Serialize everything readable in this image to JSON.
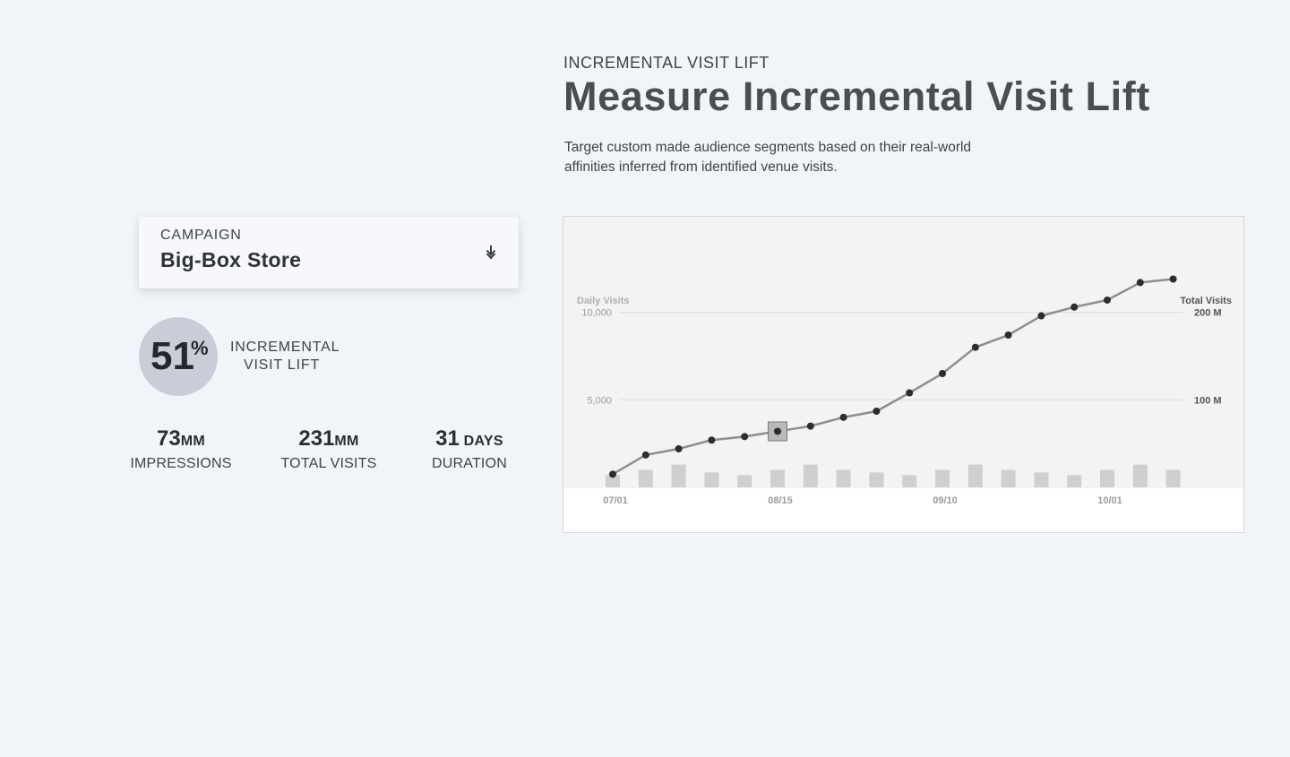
{
  "header": {
    "eyebrow": "INCREMENTAL VISIT LIFT",
    "title": "Measure Incremental Visit Lift",
    "description": "Target custom made audience segments based on their real-world affinities inferred from identified venue visits."
  },
  "campaign": {
    "label": "CAMPAIGN",
    "value": "Big-Box Store",
    "download_icon": "download-icon"
  },
  "lift": {
    "value": "51",
    "unit": "%",
    "label_line1": "INCREMENTAL",
    "label_line2": "VISIT LIFT"
  },
  "stats": [
    {
      "value": "73",
      "unit": "MM",
      "label": "IMPRESSIONS"
    },
    {
      "value": "231",
      "unit": "MM",
      "label": "TOTAL VISITS"
    },
    {
      "value": "31",
      "unit": " DAYS",
      "label": "DURATION"
    }
  ],
  "colors": {
    "background": "#f1f4f9",
    "chart_panel": "#f3f3f3",
    "line": "#8e8e8e",
    "point": "#2d2d2d",
    "bar": "#cfcfcf",
    "circle": "#c9cdd8"
  },
  "chart_data": {
    "type": "line",
    "left_axis": {
      "title": "Daily Visits",
      "ticks": [
        "10,000",
        "5,000"
      ],
      "tick_values": [
        10000,
        5000
      ],
      "range": [
        0,
        13000
      ]
    },
    "right_axis": {
      "title": "Total Visits",
      "ticks": [
        "200 M",
        "100 M"
      ],
      "tick_values": [
        200,
        100
      ],
      "range": [
        0,
        260
      ]
    },
    "x_ticks": [
      {
        "label": "07/01",
        "index": 0
      },
      {
        "label": "08/15",
        "index": 5
      },
      {
        "label": "09/10",
        "index": 10
      },
      {
        "label": "10/01",
        "index": 15
      }
    ],
    "grid": true,
    "highlight_index": 5,
    "series": [
      {
        "name": "Total Visits",
        "axis": "right",
        "values": [
          15,
          37,
          44,
          54,
          58,
          64,
          70,
          80,
          87,
          108,
          130,
          160,
          174,
          196,
          206,
          214,
          234,
          238
        ]
      },
      {
        "name": "Daily Visits",
        "axis": "left",
        "type": "bar",
        "values": [
          700,
          1000,
          1300,
          850,
          700,
          1000,
          1300,
          1000,
          850,
          700,
          1000,
          1300,
          1000,
          850,
          700,
          1000,
          1300,
          1000
        ]
      }
    ]
  }
}
